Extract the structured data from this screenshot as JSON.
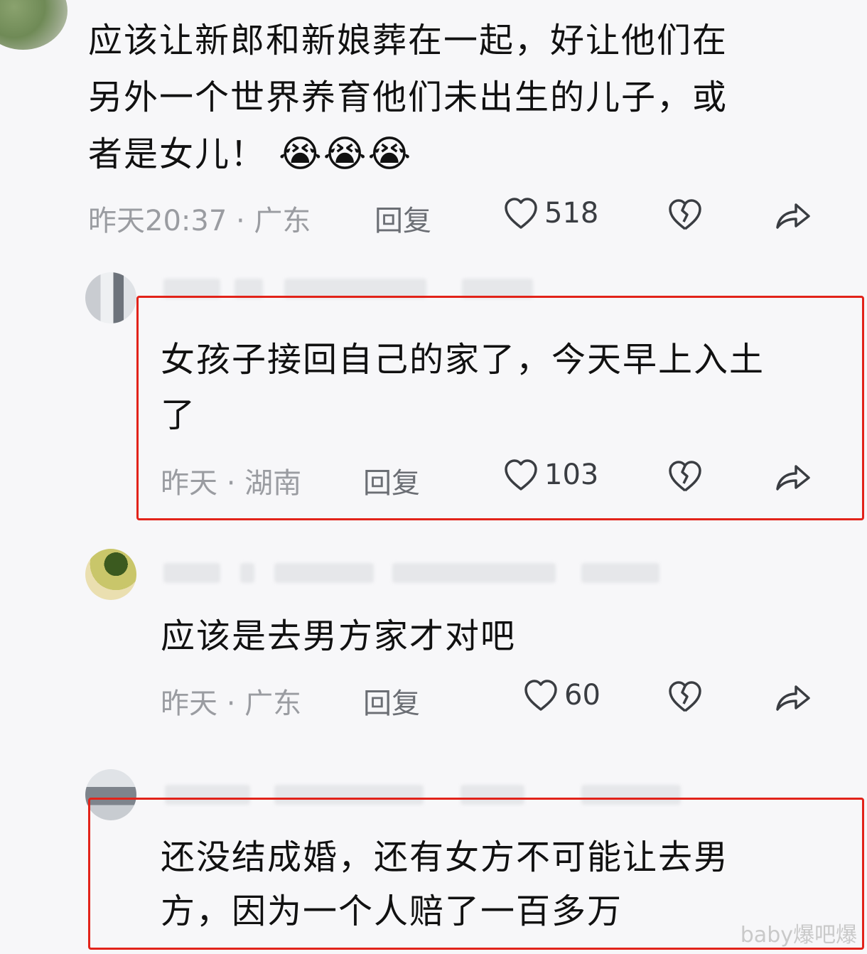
{
  "comments": [
    {
      "text_lines": [
        "应该让新郎和新娘葬在一起，好让他们在",
        "另外一个世界养育他们未出生的儿子，或",
        "者是女儿！"
      ],
      "emoji": "😭😭😭",
      "meta": "昨天20:37 · 广东",
      "reply": "回复",
      "likes": "518"
    },
    {
      "text_lines": [
        "女孩子接回自己的家了，今天早上入土",
        "了"
      ],
      "meta": "昨天 · 湖南",
      "reply": "回复",
      "likes": "103"
    },
    {
      "text_lines": [
        "应该是去男方家才对吧"
      ],
      "meta": "昨天 · 广东",
      "reply": "回复",
      "likes": "60"
    },
    {
      "text_lines": [
        "还没结成婚，还有女方不可能让去男",
        "方，因为一个人赔了一百多万"
      ]
    }
  ],
  "icons": {
    "like": "heart-outline-icon",
    "dislike": "broken-heart-icon",
    "share": "share-arrow-icon"
  },
  "colors": {
    "highlight_border": "#e2231a",
    "meta_text": "#9a9ca1"
  },
  "watermark": "baby爆吧爆"
}
